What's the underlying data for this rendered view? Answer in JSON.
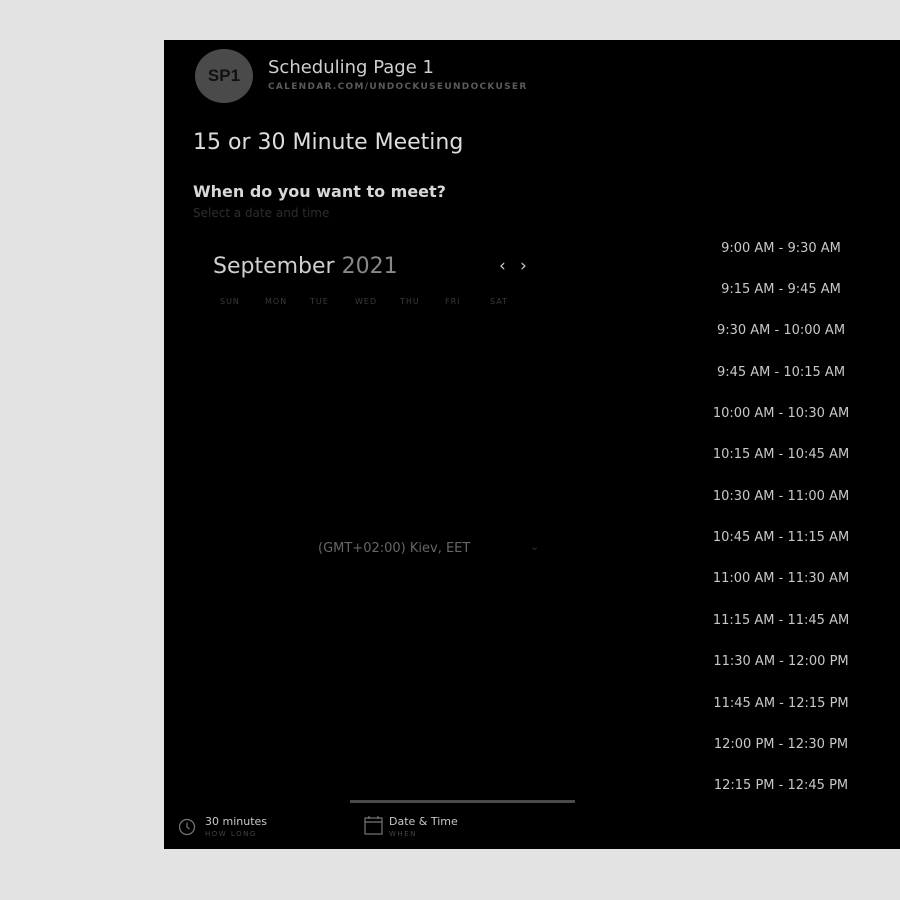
{
  "header": {
    "avatar_initials": "SP1",
    "page_name": "Scheduling Page 1",
    "page_url": "CALENDAR.COM/UNDOCKUSEUNDOCKUSER"
  },
  "meeting": {
    "title": "15 or 30 Minute Meeting",
    "question": "When do you want to meet?",
    "subtext": "Select a date and time"
  },
  "calendar": {
    "month": "September",
    "year": "2021",
    "prev_label": "‹",
    "next_label": "›",
    "weekdays": [
      "SUN",
      "MON",
      "TUE",
      "WED",
      "THU",
      "FRI",
      "SAT"
    ]
  },
  "timezone": {
    "label": "(GMT+02:00) Kiev, EET",
    "arrow": "⌄"
  },
  "time_slots": [
    "9:00 AM - 9:30 AM",
    "9:15 AM - 9:45 AM",
    "9:30 AM - 10:00 AM",
    "9:45 AM - 10:15 AM",
    "10:00 AM - 10:30 AM",
    "10:15 AM - 10:45 AM",
    "10:30 AM - 11:00 AM",
    "10:45 AM - 11:15 AM",
    "11:00 AM - 11:30 AM",
    "11:15 AM - 11:45 AM",
    "11:30 AM - 12:00 PM",
    "11:45 AM - 12:15 PM",
    "12:00 PM - 12:30 PM",
    "12:15 PM - 12:45 PM"
  ],
  "footer": {
    "duration": {
      "title": "30 minutes",
      "sub": "HOW LONG",
      "icon": "clock-icon"
    },
    "date_time": {
      "title": "Date & Time",
      "sub": "WHEN",
      "icon": "calendar-icon"
    }
  },
  "colors": {
    "panel_bg": "#000000",
    "page_bg": "#e3e3e3",
    "avatar_bg": "#4a4a4a"
  }
}
